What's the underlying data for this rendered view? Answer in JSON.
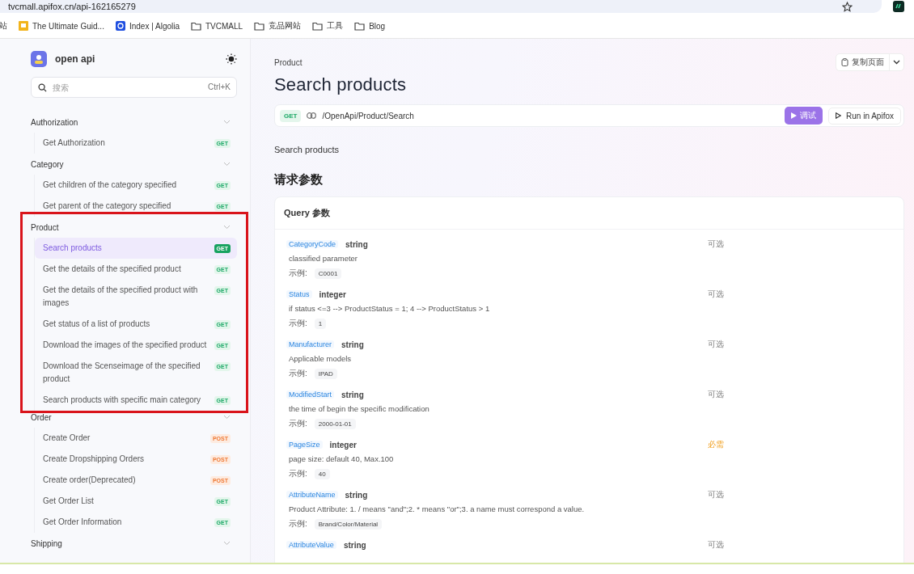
{
  "browser": {
    "url": "tvcmall.apifox.cn/api-162165279",
    "bookmarks": [
      {
        "kind": "site",
        "label": "站"
      },
      {
        "kind": "site-yellow",
        "label": "The Ultimate Guid..."
      },
      {
        "kind": "site-blue",
        "label": "Index | Algolia"
      },
      {
        "kind": "folder",
        "label": "TVCMALL"
      },
      {
        "kind": "folder",
        "label": "竞品网站"
      },
      {
        "kind": "folder",
        "label": "工具"
      },
      {
        "kind": "folder",
        "label": "Blog"
      }
    ]
  },
  "sidebar": {
    "project": "open api",
    "search": {
      "placeholder": "搜索",
      "shortcut": "Ctrl+K"
    },
    "groups": [
      {
        "name": "Authorization",
        "highlighted": false,
        "items": [
          {
            "label": "Get Authorization",
            "method": "GET",
            "selected": false
          }
        ]
      },
      {
        "name": "Category",
        "highlighted": false,
        "items": [
          {
            "label": "Get children of the category specified",
            "method": "GET",
            "selected": false
          },
          {
            "label": "Get parent of the category specified",
            "method": "GET",
            "selected": false
          }
        ]
      },
      {
        "name": "Product",
        "highlighted": true,
        "items": [
          {
            "label": "Search products",
            "method": "GET",
            "selected": true
          },
          {
            "label": "Get the details of the specified product",
            "method": "GET",
            "selected": false
          },
          {
            "label": "Get the details of the specified product with images",
            "method": "GET",
            "selected": false
          },
          {
            "label": "Get status of a list of products",
            "method": "GET",
            "selected": false
          },
          {
            "label": "Download the images of the specified product",
            "method": "GET",
            "selected": false
          },
          {
            "label": "Download the Scenseimage of the specified product",
            "method": "GET",
            "selected": false
          },
          {
            "label": "Search products with specific main category",
            "method": "GET",
            "selected": false
          }
        ]
      },
      {
        "name": "Order",
        "highlighted": false,
        "items": [
          {
            "label": "Create Order",
            "method": "POST",
            "selected": false
          },
          {
            "label": "Create Dropshipping Orders",
            "method": "POST",
            "selected": false
          },
          {
            "label": "Create order(Deprecated)",
            "method": "POST",
            "selected": false
          },
          {
            "label": "Get Order List",
            "method": "GET",
            "selected": false
          },
          {
            "label": "Get Order Information",
            "method": "GET",
            "selected": false
          }
        ]
      },
      {
        "name": "Shipping",
        "highlighted": false
      }
    ]
  },
  "main": {
    "breadcrumb": "Product",
    "title": "Search products",
    "copy_button": "复制页面",
    "endpoint": {
      "method": "GET",
      "path": "/OpenApi/Product/Search"
    },
    "debug_button": "调试",
    "run_button": "Run in Apifox",
    "description": "Search products",
    "section_title": "请求参数",
    "query": {
      "title": "Query 参数",
      "params": [
        {
          "name": "CategoryCode",
          "type": "string",
          "required": false,
          "flag": "可选",
          "description": "classified parameter",
          "example_label": "示例:",
          "example": "C0001"
        },
        {
          "name": "Status",
          "type": "integer",
          "required": false,
          "flag": "可选",
          "description": "if status <=3 --> ProductStatus = 1; 4 --> ProductStatus > 1",
          "example_label": "示例:",
          "example": "1"
        },
        {
          "name": "Manufacturer",
          "type": "string",
          "required": false,
          "flag": "可选",
          "description": "Applicable models",
          "example_label": "示例:",
          "example": "IPAD"
        },
        {
          "name": "ModifiedStart",
          "type": "string",
          "required": false,
          "flag": "可选",
          "description": "the time of begin the specific modification",
          "example_label": "示例:",
          "example": "2000-01-01"
        },
        {
          "name": "PageSize",
          "type": "integer",
          "required": true,
          "flag": "必需",
          "description": "page size: default 40, Max.100",
          "example_label": "示例:",
          "example": "40"
        },
        {
          "name": "AttributeName",
          "type": "string",
          "required": false,
          "flag": "可选",
          "description": "Product Attribute: 1. / means \"and\";2. * means \"or\";3. a name must correspond a value.",
          "example_label": "示例:",
          "example": "Brand/Color/Material"
        },
        {
          "name": "AttributeValue",
          "type": "string",
          "required": false,
          "flag": "可选"
        }
      ]
    }
  }
}
